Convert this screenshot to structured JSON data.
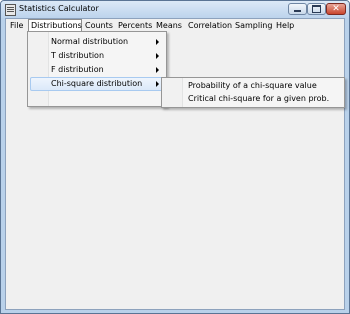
{
  "window": {
    "title": "Statistics Calculator"
  },
  "menubar": {
    "items": [
      {
        "label": "File"
      },
      {
        "label": "Distributions"
      },
      {
        "label": "Counts"
      },
      {
        "label": "Percents"
      },
      {
        "label": "Means"
      },
      {
        "label": "Correlation"
      },
      {
        "label": "Sampling"
      },
      {
        "label": "Help"
      }
    ]
  },
  "distributions_menu": {
    "items": [
      {
        "label": "Normal distribution"
      },
      {
        "label": "T distribution"
      },
      {
        "label": "F distribution"
      },
      {
        "label": "Chi-square distribution"
      }
    ]
  },
  "chi_square_submenu": {
    "items": [
      {
        "label": "Probability of a chi-square value"
      },
      {
        "label": "Critical chi-square for a given prob."
      }
    ]
  }
}
